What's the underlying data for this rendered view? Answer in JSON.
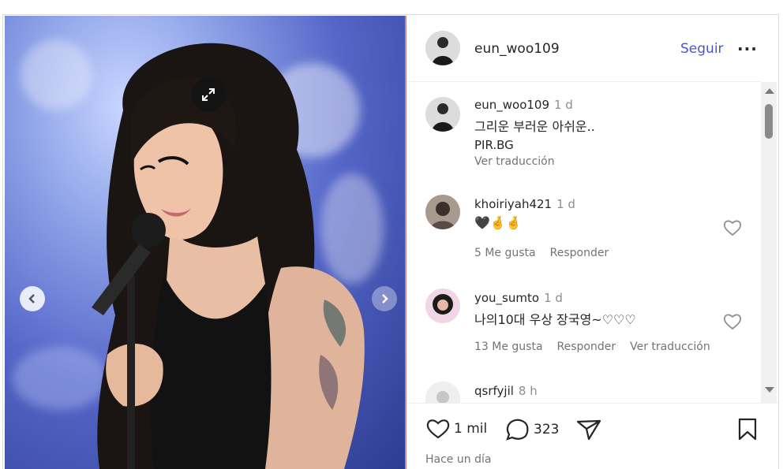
{
  "post": {
    "author": "eun_woo109",
    "follow_label": "Seguir",
    "more_label": "···"
  },
  "comments": [
    {
      "user": "eun_woo109",
      "time": "1 d",
      "text": "그리운 부러운 아쉬운..",
      "line2": "PIR.BG",
      "translate": "Ver traducción"
    },
    {
      "user": "khoiriyah421",
      "time": "1 d",
      "text": "🖤🤞🤞",
      "likes": "5 Me gusta",
      "reply": "Responder"
    },
    {
      "user": "you_sumto",
      "time": "1 d",
      "text": "나의10대 우상 장국영~♡♡♡",
      "likes": "13 Me gusta",
      "reply": "Responder",
      "translate": "Ver traducción"
    },
    {
      "user": "qsrfyjil",
      "time": "8 h"
    }
  ],
  "footer": {
    "likes": "1 mil",
    "comments": "323",
    "posted": "Hace un día"
  },
  "colors": {
    "accent": "#4a55c8",
    "muted": "#737373"
  }
}
